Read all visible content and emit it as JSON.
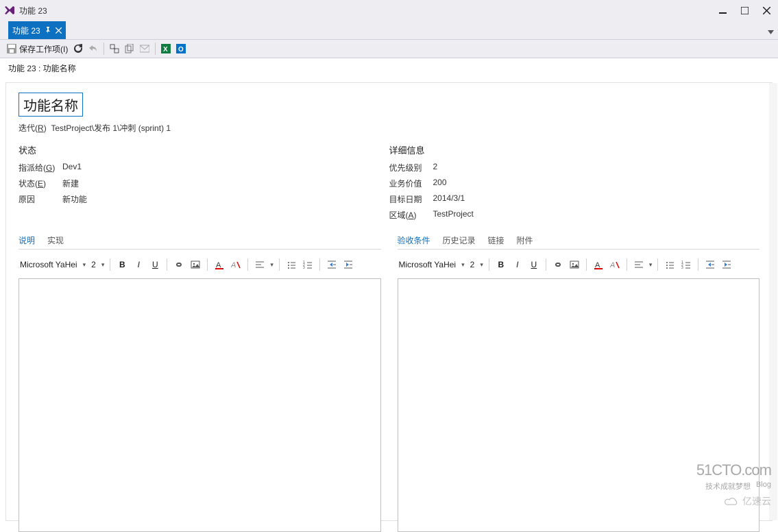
{
  "window": {
    "title": "功能 23"
  },
  "tab": {
    "label": "功能 23"
  },
  "toolbar": {
    "save": "保存工作项(I)"
  },
  "breadcrumb": {
    "text": "功能 23 : 功能名称"
  },
  "item": {
    "title": "功能名称",
    "iteration_prefix": "迭代",
    "iteration_key": "R",
    "iteration_path": "TestProject\\发布 1\\冲刺 (sprint) 1"
  },
  "left": {
    "heading": "状态",
    "fields": [
      {
        "label_pre": "指派给(",
        "key": "G",
        "label_post": ")",
        "value": "Dev1"
      },
      {
        "label_pre": "状态(",
        "key": "E",
        "label_post": ")",
        "value": "新建"
      },
      {
        "label_pre": "原因",
        "key": "",
        "label_post": "",
        "value": "新功能"
      }
    ]
  },
  "right": {
    "heading": "详细信息",
    "fields": [
      {
        "label": "优先级别",
        "value": "2"
      },
      {
        "label": "业务价值",
        "value": "200"
      },
      {
        "label": "目标日期",
        "value": "2014/3/1"
      },
      {
        "label_pre": "区域(",
        "key": "A",
        "label_post": ")",
        "value": "TestProject"
      }
    ]
  },
  "panels": {
    "left_tabs": [
      "说明",
      "实现"
    ],
    "right_tabs": [
      "验收条件",
      "历史记录",
      "链接",
      "附件"
    ]
  },
  "rtf": {
    "font": "Microsoft YaHei",
    "size": "2"
  },
  "watermark": {
    "cto": "51CTO.com",
    "cto_sub": "技术成就梦想",
    "blog": "Blog",
    "ysy": "亿速云"
  }
}
